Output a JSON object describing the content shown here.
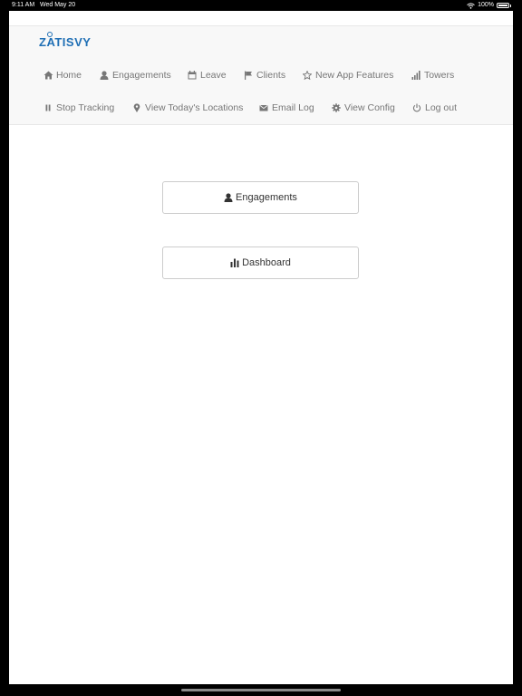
{
  "status_bar": {
    "time": "9:11 AM",
    "date": "Wed May 20",
    "battery": "100%"
  },
  "navbar": {
    "brand": "ZATISVY",
    "items": [
      {
        "label": "Home",
        "icon": "home-icon"
      },
      {
        "label": "Engagements",
        "icon": "user-icon"
      },
      {
        "label": "Leave",
        "icon": "calendar-icon"
      },
      {
        "label": "Clients",
        "icon": "flag-icon"
      },
      {
        "label": "New App Features",
        "icon": "star-icon"
      },
      {
        "label": "Towers",
        "icon": "signal-icon"
      },
      {
        "label": "Stop Tracking",
        "icon": "pause-icon"
      },
      {
        "label": "View Today's Locations",
        "icon": "map-marker-icon"
      },
      {
        "label": "Email Log",
        "icon": "envelope-icon"
      },
      {
        "label": "View Config",
        "icon": "gear-icon"
      },
      {
        "label": "Log out",
        "icon": "power-icon"
      }
    ]
  },
  "main": {
    "buttons": [
      {
        "label": "Engagements",
        "icon": "user-icon"
      },
      {
        "label": "Dashboard",
        "icon": "bar-chart-icon"
      }
    ]
  },
  "colors": {
    "brand": "#1f6fb5",
    "navbar_bg": "#f8f8f8",
    "nav_text": "#777777"
  }
}
